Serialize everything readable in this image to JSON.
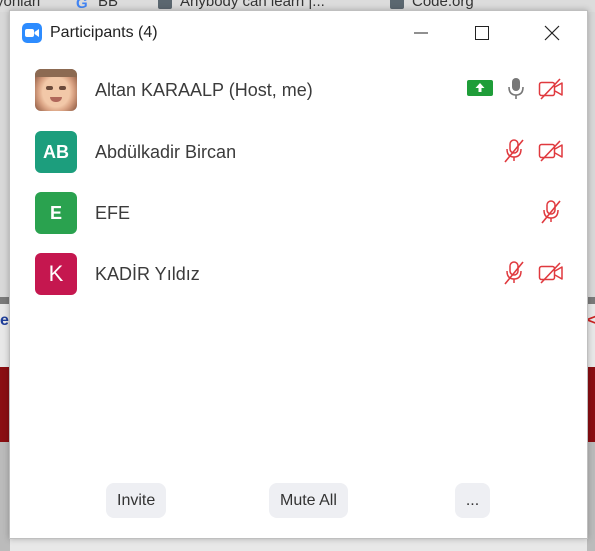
{
  "background": {
    "bookmarks": [
      {
        "label": "yonlari"
      },
      {
        "label": "BB"
      },
      {
        "label": "Anybody can learn |..."
      },
      {
        "label": "Code.org"
      }
    ],
    "left_fragment": "e",
    "right_fragment": "<"
  },
  "window": {
    "title": "Participants (4)",
    "controls": [
      "minimize",
      "maximize",
      "close"
    ]
  },
  "participants": [
    {
      "name": "Altan KARAALP (Host, me)",
      "avatar": "photo",
      "icons": [
        "share-screen-icon",
        "microphone-icon",
        "video-off-icon"
      ]
    },
    {
      "name": "Abdülkadir Bircan",
      "avatar_initials": "AB",
      "avatar_color": "#1c9e7d",
      "icons": [
        "microphone-muted-icon",
        "video-off-icon"
      ]
    },
    {
      "name": "EFE",
      "avatar_initials": "E",
      "avatar_color": "#2aa24f",
      "icons": [
        "microphone-muted-icon"
      ]
    },
    {
      "name": "KADİR Yıldız",
      "avatar_initials": "K",
      "avatar_color": "#c5174f",
      "icons": [
        "microphone-muted-icon",
        "video-off-icon"
      ]
    }
  ],
  "buttons": {
    "invite": "Invite",
    "mute_all": "Mute All",
    "more": "..."
  },
  "colors": {
    "accent": "#2d8cff",
    "muted_red": "#e0393e",
    "share_green": "#1f9d39"
  }
}
